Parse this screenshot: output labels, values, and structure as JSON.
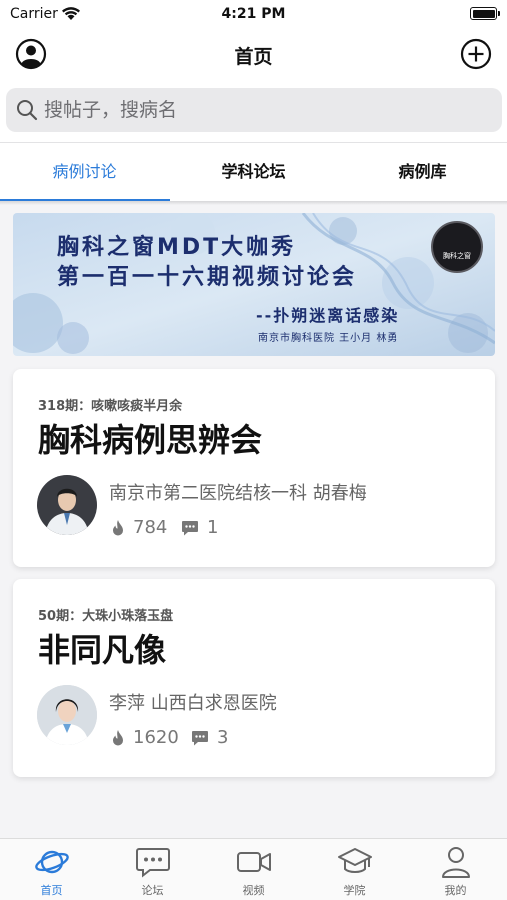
{
  "status_bar": {
    "carrier": "Carrier",
    "time": "4:21 PM"
  },
  "nav": {
    "title": "首页",
    "left_icon": "profile-icon",
    "right_icon": "add-circle-icon"
  },
  "search": {
    "placeholder": "搜帖子，搜病名"
  },
  "tabs": [
    {
      "label": "病例讨论",
      "active": true
    },
    {
      "label": "学科论坛",
      "active": false
    },
    {
      "label": "病例库",
      "active": false
    }
  ],
  "banner": {
    "line1": "胸科之窗MDT大咖秀",
    "line2": "第一百一十六期视频讨论会",
    "line3": "--扑朔迷离话感染",
    "line4": "南京市胸科医院  王小月  林勇",
    "logo_text": "胸科之窗"
  },
  "cases": [
    {
      "episode": "318期：咳嗽咳痰半月余",
      "title": "胸科病例思辨会",
      "author": "南京市第二医院结核一科 胡春梅",
      "views": "784",
      "comments": "1"
    },
    {
      "episode": "50期：大珠小珠落玉盘",
      "title": "非同凡像",
      "author": "李萍 山西白求恩医院",
      "views": "1620",
      "comments": "3"
    }
  ],
  "tabbar": [
    {
      "label": "首页",
      "icon": "planet-icon",
      "active": true
    },
    {
      "label": "论坛",
      "icon": "chat-icon",
      "active": false
    },
    {
      "label": "视频",
      "icon": "video-icon",
      "active": false
    },
    {
      "label": "学院",
      "icon": "graduation-cap-icon",
      "active": false
    },
    {
      "label": "我的",
      "icon": "person-icon",
      "active": false
    }
  ],
  "colors": {
    "accent": "#2b7bd9",
    "background": "#f4f4f6",
    "banner_text": "#1c2e6e"
  }
}
